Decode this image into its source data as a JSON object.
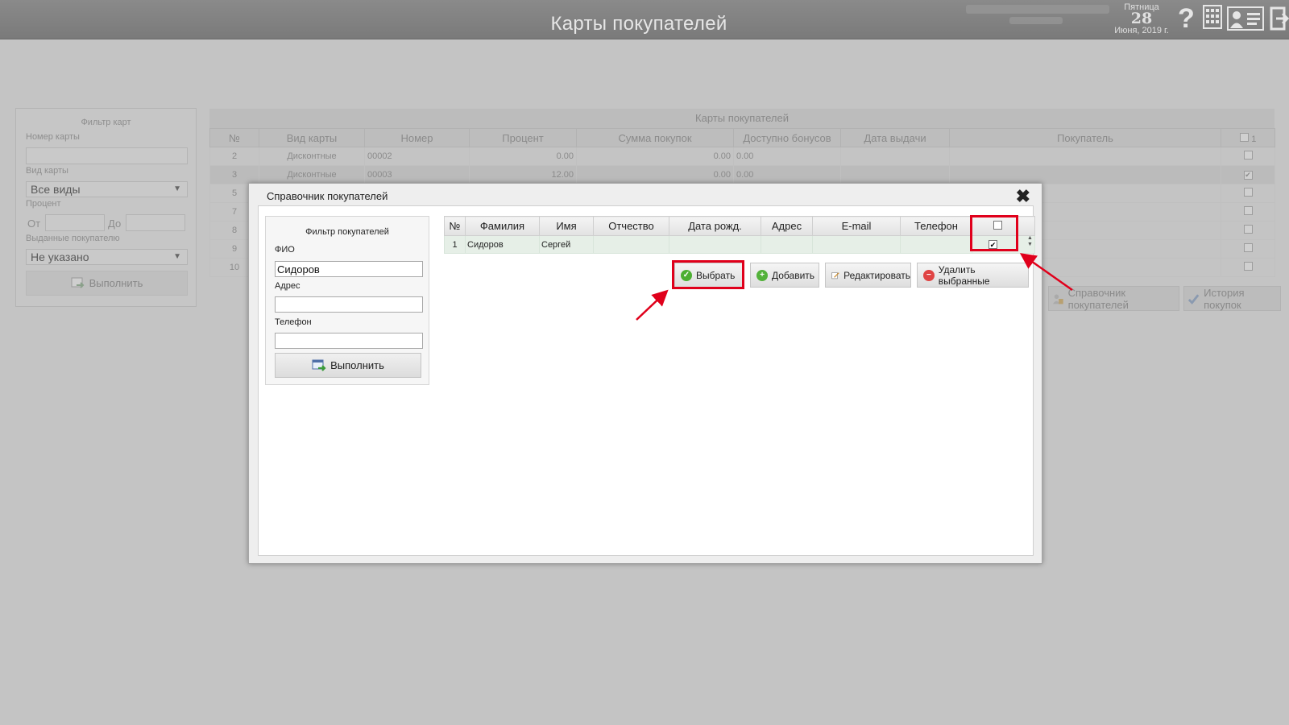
{
  "header": {
    "title": "Карты покупателей",
    "date": {
      "weekday": "Пятница",
      "day": "28",
      "month_year": "Июня, 2019 г."
    }
  },
  "card_filter": {
    "title": "Фильтр карт",
    "card_number_label": "Номер карты",
    "card_number_value": "",
    "card_type_label": "Вид карты",
    "card_type_value": "Все виды",
    "percent_label": "Процент",
    "from_label": "От",
    "to_label": "До",
    "issued_label": "Выданные покупателю",
    "issued_value": "Не указано",
    "execute_label": "Выполнить"
  },
  "cards_grid": {
    "title": "Карты покупателей",
    "columns": [
      "№",
      "Вид карты",
      "Номер",
      "Процент",
      "Сумма покупок",
      "Доступно бонусов",
      "Дата выдачи",
      "Покупатель"
    ],
    "header_count": "1",
    "rows": [
      {
        "n": "2",
        "type": "Дисконтные",
        "number": "00002",
        "percent": "0.00",
        "sum": "0.00",
        "bonus": "0.00",
        "checked": ""
      },
      {
        "n": "3",
        "type": "Дисконтные",
        "number": "00003",
        "percent": "12.00",
        "sum": "0.00",
        "bonus": "0.00",
        "checked": "✔"
      },
      {
        "n": "5",
        "type": "",
        "number": "",
        "percent": "",
        "sum": "",
        "bonus": "",
        "checked": ""
      },
      {
        "n": "7",
        "type": "",
        "number": "",
        "percent": "",
        "sum": "",
        "bonus": "",
        "checked": ""
      },
      {
        "n": "8",
        "type": "",
        "number": "",
        "percent": "",
        "sum": "",
        "bonus": "",
        "checked": ""
      },
      {
        "n": "9",
        "type": "",
        "number": "",
        "percent": "",
        "sum": "",
        "bonus": "",
        "checked": ""
      },
      {
        "n": "10",
        "type": "",
        "number": "",
        "percent": "",
        "sum": "",
        "bonus": "",
        "checked": ""
      }
    ],
    "buttons": {
      "customers_ref": "Справочник покупателей",
      "history": "История покупок"
    }
  },
  "modal": {
    "title": "Справочник покупателей",
    "filter": {
      "title": "Фильтр покупателей",
      "fio_label": "ФИО",
      "fio_value": "Сидоров",
      "address_label": "Адрес",
      "address_value": "",
      "phone_label": "Телефон",
      "phone_value": "",
      "execute_label": "Выполнить"
    },
    "grid": {
      "columns": [
        "№",
        "Фамилия",
        "Имя",
        "Отчество",
        "Дата рожд.",
        "Адрес",
        "E-mail",
        "Телефон"
      ],
      "rows": [
        {
          "n": "1",
          "last_name": "Сидоров",
          "first_name": "Сергей",
          "middle_name": "",
          "birth_date": "",
          "address": "",
          "email": "",
          "phone": "",
          "checked": "✔"
        }
      ]
    },
    "buttons": {
      "select": "Выбрать",
      "add": "Добавить",
      "edit": "Редактировать",
      "delete_selected": "Удалить выбранные"
    }
  },
  "colors": {
    "highlight": "#e0001b",
    "selected_row": "#e6efe7"
  }
}
